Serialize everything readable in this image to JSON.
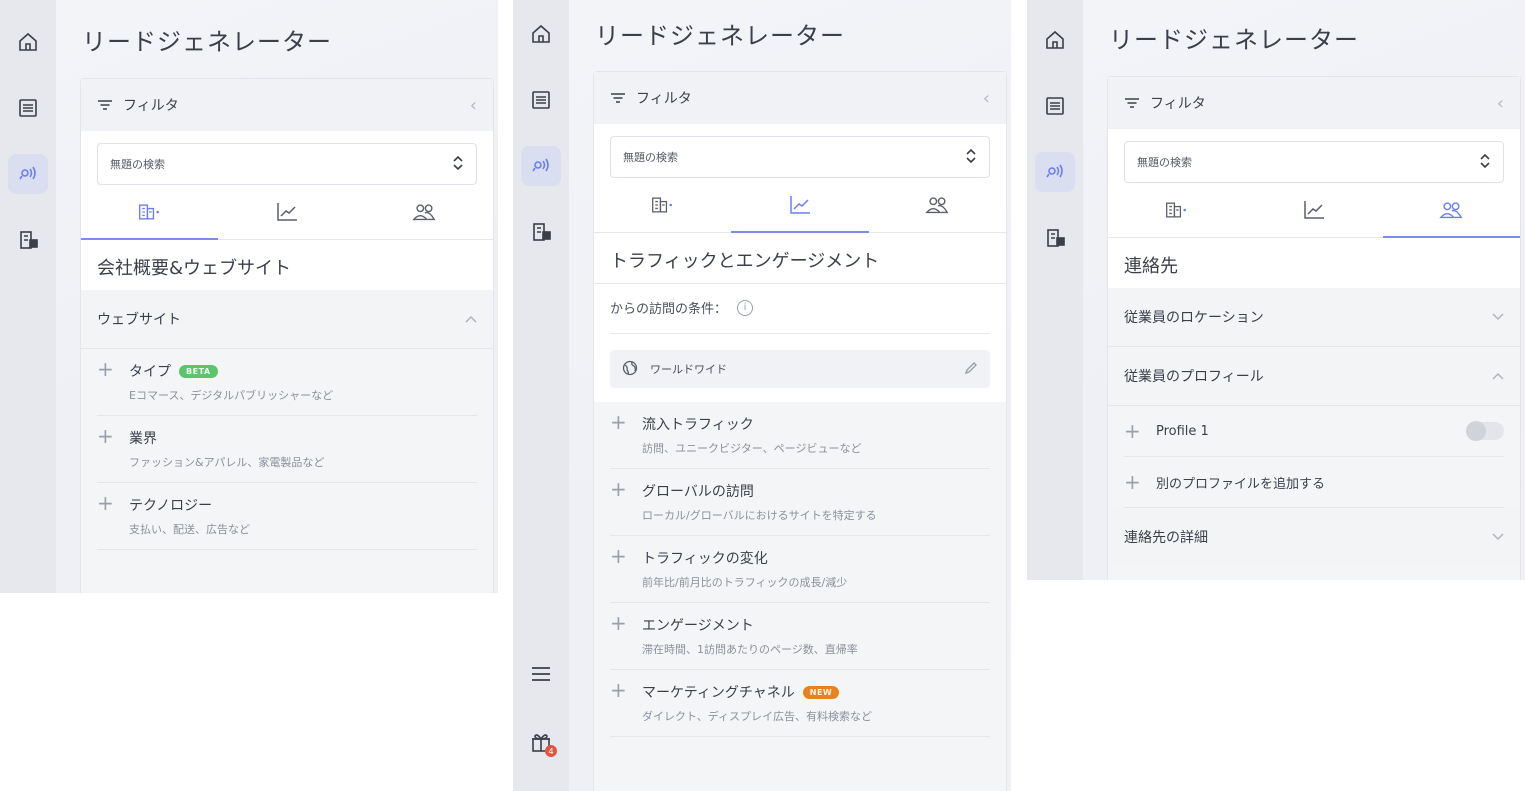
{
  "app": {
    "title": "リードジェネレーター"
  },
  "filter": {
    "label": "フィルタ",
    "search_value": "無題の検索"
  },
  "panel1": {
    "section_title": "会社概要&ウェブサイト",
    "group": "ウェブサイト",
    "items": [
      {
        "title": "タイプ",
        "badge": "BETA",
        "desc": "Eコマース、デジタルパブリッシャーなど"
      },
      {
        "title": "業界",
        "desc": "ファッション&アパレル、家電製品など"
      },
      {
        "title": "テクノロジー",
        "desc": "支払い、配送、広告など"
      }
    ]
  },
  "panel2": {
    "section_title": "トラフィックとエンゲージメント",
    "condition_label": "からの訪問の条件：",
    "info_icon": "i",
    "worldwide": "ワールドワイド",
    "items": [
      {
        "title": "流入トラフィック",
        "desc": "訪問、ユニークビジター、ページビューなど"
      },
      {
        "title": "グローバルの訪問",
        "desc": "ローカル/グローバルにおけるサイトを特定する"
      },
      {
        "title": "トラフィックの変化",
        "desc": "前年比/前月比のトラフィックの成長/減少"
      },
      {
        "title": "エンゲージメント",
        "desc": "滞在時間、1訪問あたりのページ数、直帰率"
      },
      {
        "title": "マーケティングチャネル",
        "badge": "NEW",
        "desc": "ダイレクト、ディスプレイ広告、有料検索など"
      }
    ],
    "gift_count": "4"
  },
  "panel3": {
    "section_title": "連絡先",
    "groups": {
      "location": "従業員のロケーション",
      "profile": "従業員のプロフィール",
      "details": "連絡先の詳細"
    },
    "profile_item": "Profile 1",
    "add_profile": "別のプロファイルを追加する"
  },
  "icons": {
    "rail": [
      "home-icon",
      "list-icon",
      "radar-icon",
      "building-grid-icon",
      "menu-icon",
      "gift-icon"
    ],
    "tabs": [
      "building-icon",
      "chart-icon",
      "people-icon"
    ],
    "colors": {
      "accent": "#7b8cf0",
      "rail_bg": "#e6e8ed",
      "beta": "#5cc46b",
      "new": "#e7821e"
    }
  }
}
